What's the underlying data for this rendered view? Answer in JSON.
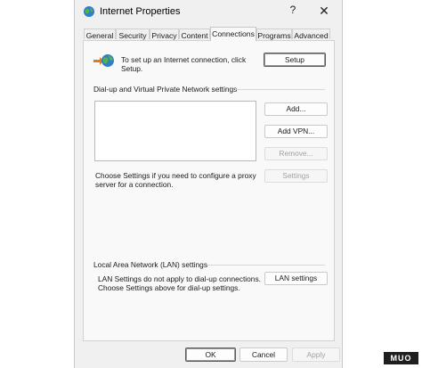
{
  "window": {
    "title": "Internet Properties",
    "help_glyph": "?",
    "close_glyph": "✕"
  },
  "tabs": [
    "General",
    "Security",
    "Privacy",
    "Content",
    "Connections",
    "Programs",
    "Advanced"
  ],
  "active_tab": "Connections",
  "setup": {
    "text": "To set up an Internet connection, click Setup.",
    "button": "Setup"
  },
  "dialup": {
    "label": "Dial-up and Virtual Private Network settings",
    "add_button": "Add...",
    "add_vpn_button": "Add VPN...",
    "remove_button": "Remove...",
    "settings_button": "Settings",
    "proxy_text": "Choose Settings if you need to configure a proxy server for a connection."
  },
  "lan": {
    "label": "Local Area Network (LAN) settings",
    "text": "LAN Settings do not apply to dial-up connections. Choose Settings above for dial-up settings.",
    "button": "LAN settings"
  },
  "footer": {
    "ok": "OK",
    "cancel": "Cancel",
    "apply": "Apply"
  },
  "watermark": "MUO",
  "colors": {
    "panel_bg": "#f9f9f9",
    "window_bg": "#f0f0f0",
    "disabled_text": "#a2a2a2"
  },
  "icons": {
    "title": "globe-icon",
    "setup": "globe-connect-icon"
  }
}
